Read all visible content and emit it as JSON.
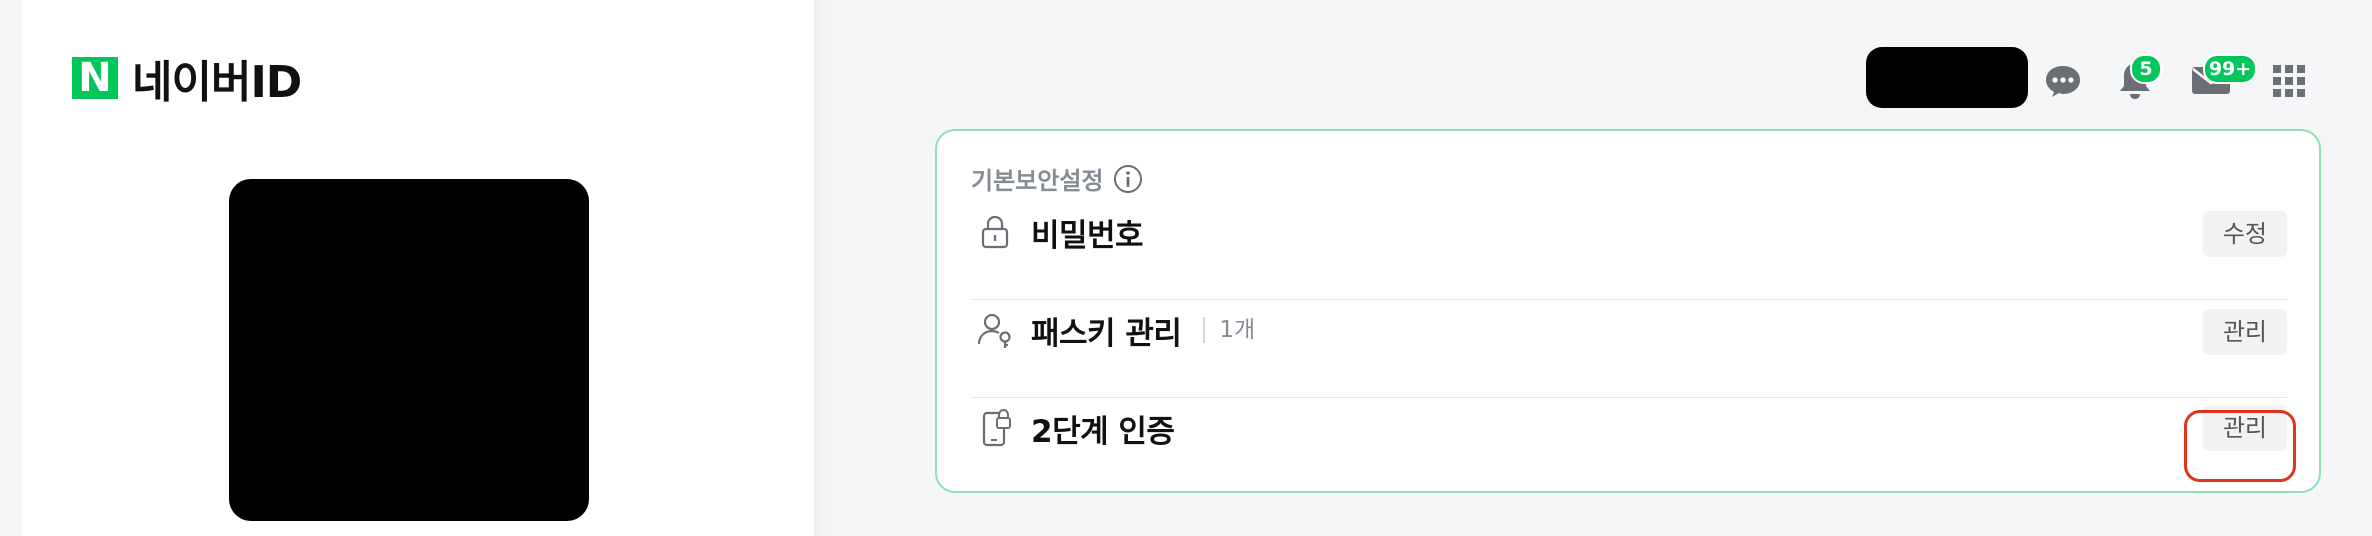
{
  "brand": {
    "logo_letter": "N",
    "title": "네이버ID",
    "accent": "#03c75a"
  },
  "topbar": {
    "notification_count": "5",
    "mail_count": "99+"
  },
  "security_card": {
    "title": "기본보안설정",
    "rows": [
      {
        "label": "비밀번호",
        "count": "",
        "button": "수정",
        "icon": "lock-icon"
      },
      {
        "label": "패스키 관리",
        "count": "1개",
        "button": "관리",
        "icon": "passkey-icon"
      },
      {
        "label": "2단계 인증",
        "count": "",
        "button": "관리",
        "icon": "phone-lock-icon"
      }
    ]
  },
  "colors": {
    "card_border": "#8fe0b2",
    "highlight": "#e0341b"
  }
}
